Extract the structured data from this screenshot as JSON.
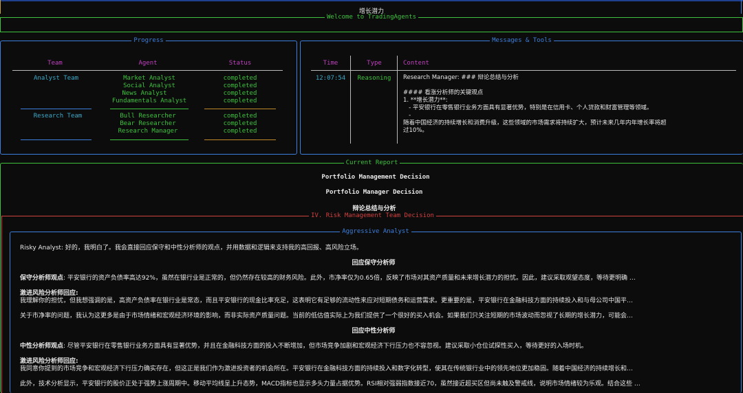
{
  "colors": {
    "bg": "#0c0c0c",
    "green": "#3fc33f",
    "blue": "#3d7fdc",
    "red": "#d24040",
    "magenta": "#c040c0",
    "cyan": "#3aa9c9",
    "orange": "#c08a2a"
  },
  "top": {
    "heading": "增长潜力",
    "welcome": "Welcome to TradingAgents"
  },
  "progress": {
    "title": "Progress",
    "headers": {
      "team": "Team",
      "agent": "Agent",
      "status": "Status"
    },
    "groups": [
      {
        "team": "Analyst Team",
        "agents": [
          "Market Analyst",
          "Social Analyst",
          "News Analyst",
          "Fundamentals Analyst"
        ],
        "statuses": [
          "completed",
          "completed",
          "completed",
          "completed"
        ]
      },
      {
        "team": "Research Team",
        "agents": [
          "Bull Researcher",
          "Bear Researcher",
          "Research Manager"
        ],
        "statuses": [
          "completed",
          "completed",
          "completed"
        ]
      }
    ]
  },
  "messages": {
    "title": "Messages & Tools",
    "headers": {
      "time": "Time",
      "type": "Type",
      "content": "Content"
    },
    "row": {
      "time": "12:07:54",
      "type": "Reasoning",
      "lines": [
        "Research Manager: ### 辩论总结与分析",
        "",
        "#### 看涨分析师的关键观点",
        "1. **增长潜力**:",
        "   - 平安银行在零售银行业务方面具有显著优势，特别是在信用卡、个人贷款和财富管理等领域。",
        "   -",
        "随着中国经济的持续增长和消费升级，这些领域的市场需求将持续扩大，预计未来几年内年增长率将超",
        "过10%。"
      ]
    }
  },
  "report": {
    "title": "Current Report",
    "line1": "Portfolio Management Decision",
    "line2": "Portfolio Manager Decision",
    "line3": "辩论总结与分析",
    "risk_title": "IV. Risk Management Team Decision"
  },
  "aggressive": {
    "title": "Aggressive Analyst",
    "p1": "Risky Analyst: 好的，我明白了。我会直接回应保守和中性分析师的观点，并用数据和逻辑来支持我的高回报、高风险立场。",
    "h1": "回应保守分析师",
    "p2_label": "保守分析师观点",
    "p2": ": 平安银行的资产负债率高达92%，虽然在银行业是正常的，但仍然存在较高的财务风险。此外，市净率仅为0.65倍，反映了市场对其资产质量和未来增长潜力的担忧。因此，建议采取观望态度，等待更明确 …",
    "p3_label": "激进风险分析师回应",
    "p3_colon": ":",
    "p3": "我理解你的担忧，但我想强调的是，高资产负债率在银行业是常态，而且平安银行的现金比率充足，这表明它有足够的流动性来应对短期债务和运营需求。更重要的是，平安银行在金融科技方面的持续投入和与母公司中国平…",
    "p4": "关于市净率的问题，我认为这更多是由于市场情绪和宏观经济环境的影响，而非实际资产质量问题。当前的低估值实际上为我们提供了一个很好的买入机会。如果我们只关注短期的市场波动而忽视了长期的增长潜力，可能会…",
    "h2": "回应中性分析师",
    "p5_label": "中性分析师观点",
    "p5": ": 尽管平安银行在零售银行业务方面具有显著优势，并且在金融科技方面的投入不断增加，但市场竞争加剧和宏观经济下行压力也不容忽视。建议采取小仓位试探性买入，等待更好的入场时机。",
    "p6_label": "激进风险分析师回应",
    "p6_colon": ":",
    "p6": "我同意你提到的市场竞争和宏观经济下行压力确实存在，但这正是我们作为激进投资者的机会所在。平安银行在金融科技方面的持续投入和数字化转型，使其在传统银行业中的领先地位更加稳固。随着中国经济的持续增长和…",
    "p7": "此外，技术分析显示，平安银行的股价正处于强势上涨周期中。移动平均线呈上升态势，MACD指标也显示多头力量占据优势。RSI相对强弱指数接近70，虽然接近超买区但尚未触及警戒线，说明市场情绪较为乐观。结合这些 …"
  }
}
